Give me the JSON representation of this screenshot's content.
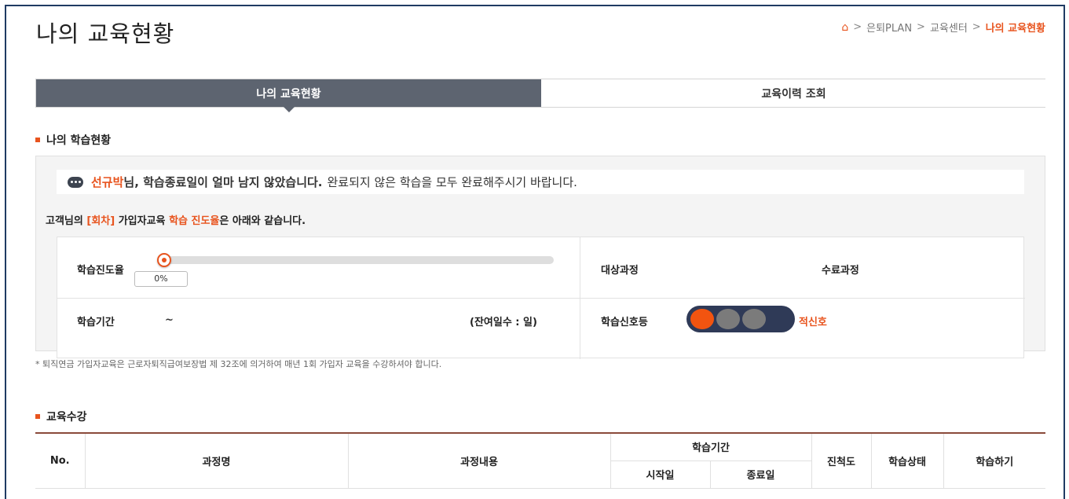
{
  "page": {
    "title": "나의 교육현황"
  },
  "breadcrumb": {
    "items": [
      "은퇴PLAN",
      "교육센터"
    ],
    "separator": ">",
    "current": "나의 교육현황"
  },
  "tabs": [
    {
      "label": "나의 교육현황",
      "active": true
    },
    {
      "label": "교육이력 조회",
      "active": false
    }
  ],
  "learning_status": {
    "section_title": "나의 학습현황",
    "notice": {
      "name": "선규박",
      "strong_suffix": "님, 학습종료일이 얼마 남지 않았습니다.",
      "rest": "완료되지 않은 학습을 모두 완료해주시기 바랍니다."
    },
    "summary": {
      "prefix": "고객님의",
      "round": "[회차]",
      "middle": "가입자교육",
      "highlight": "학습 진도율",
      "suffix": "은 아래와 같습니다."
    },
    "progress": {
      "label": "학습진도율",
      "value_text": "0%",
      "fraction": 0
    },
    "target_course_label": "대상과정",
    "completed_course_label": "수료과정",
    "period": {
      "label": "학습기간",
      "value": "~",
      "remaining": "(잔여일수 : 일)"
    },
    "signal": {
      "label": "학습신호등",
      "status_text": "적신호",
      "active_lamp": "red"
    },
    "footnote": "* 퇴직연금 가입자교육은 근로자퇴직급여보장법 제 32조에 의거하여 매년 1회 가입자 교육을 수강하셔야 합니다."
  },
  "courses": {
    "section_title": "교육수강",
    "headers": {
      "no": "No.",
      "name": "과정명",
      "content": "과정내용",
      "period": "학습기간",
      "start": "시작일",
      "end": "종료일",
      "progress": "진척도",
      "status": "학습상태",
      "action": "학습하기"
    }
  },
  "colors": {
    "accent": "#e8541e",
    "tab_active": "#5d6470",
    "signal_body": "#2f3a57",
    "signal_on": "#f25410",
    "signal_off": "#7b7b7b"
  }
}
